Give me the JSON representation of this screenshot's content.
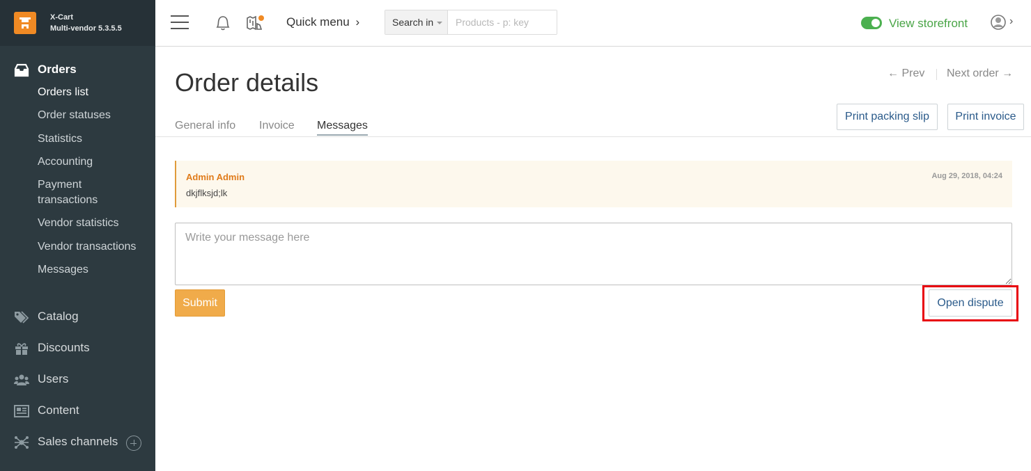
{
  "brand": {
    "name": "X-Cart",
    "version": "Multi-vendor 5.3.5.5"
  },
  "sidebar": {
    "orders": {
      "label": "Orders",
      "items": [
        "Orders list",
        "Order statuses",
        "Statistics",
        "Accounting",
        "Payment transactions",
        "Vendor statistics",
        "Vendor transactions",
        "Messages"
      ]
    },
    "sections": [
      {
        "label": "Catalog",
        "icon": "tag-icon"
      },
      {
        "label": "Discounts",
        "icon": "gift-icon"
      },
      {
        "label": "Users",
        "icon": "users-icon"
      },
      {
        "label": "Content",
        "icon": "newspaper-icon"
      },
      {
        "label": "Sales channels",
        "icon": "network-icon"
      }
    ]
  },
  "topbar": {
    "quick_menu": "Quick menu",
    "search_in": "Search in",
    "search_placeholder": "Products - p: key",
    "view_storefront": "View storefront"
  },
  "page": {
    "title": "Order details",
    "prev": "← Prev",
    "next": "Next order →",
    "tabs": [
      "General info",
      "Invoice",
      "Messages"
    ],
    "active_tab": "Messages",
    "print_packing_slip": "Print packing slip",
    "print_invoice": "Print invoice"
  },
  "message": {
    "author": "Admin Admin",
    "date": "Aug 29, 2018, 04:24",
    "text": "dkjflksjd;lk"
  },
  "composer": {
    "placeholder": "Write your message here",
    "submit": "Submit",
    "open_dispute": "Open dispute"
  },
  "colors": {
    "sidebar_bg": "#2d3a40",
    "brand_orange": "#f08a24",
    "storefront_green": "#4aa547",
    "submit_bg": "#f0ab4a",
    "highlight_red": "#e8000c"
  }
}
